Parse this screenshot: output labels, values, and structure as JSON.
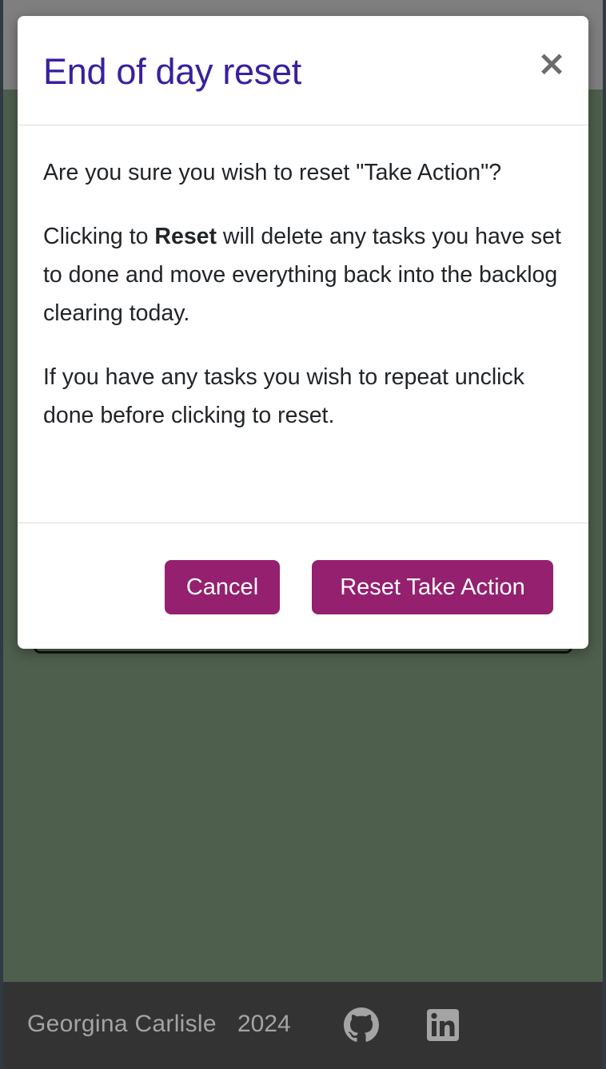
{
  "modal": {
    "title": "End of day reset",
    "close_symbol": "×",
    "paragraph1": "Are you sure you wish to reset \"Take Action\"?",
    "paragraph2_prefix": "Clicking to ",
    "paragraph2_bold": "Reset",
    "paragraph2_suffix": " will delete any tasks you have set to done and move everything back into the backlog clearing today.",
    "paragraph3": "If you have any tasks you wish to repeat unclick done before clicking to reset.",
    "cancel_label": "Cancel",
    "confirm_label": "Reset Take Action"
  },
  "footer": {
    "author": "Georgina Carlisle",
    "year": "2024",
    "icons": [
      "github-icon",
      "linkedin-icon"
    ]
  },
  "colors": {
    "title": "#3a1fa0",
    "button": "#94206f",
    "page_background": "#4e5f4d",
    "footer_background": "#333333",
    "footer_text": "#a4a4a4"
  }
}
